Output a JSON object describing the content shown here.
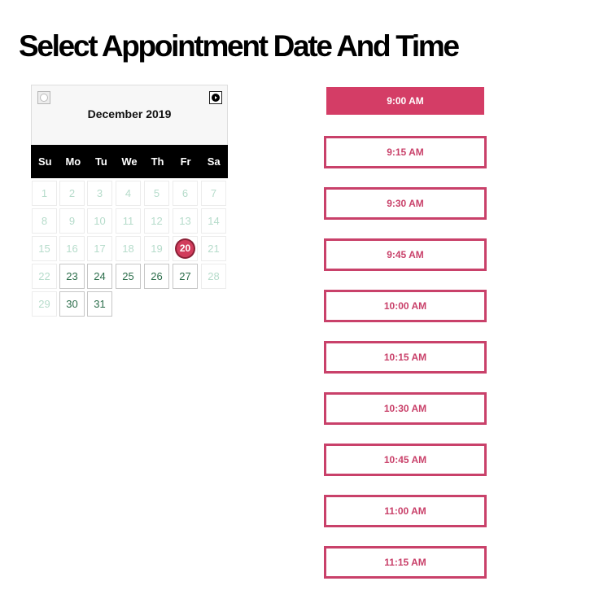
{
  "page": {
    "title": "Select Appointment Date And Time"
  },
  "calendar": {
    "month_label": "December 2019",
    "prev_icon": "prev-month-arrow-icon",
    "next_icon": "next-month-arrow-icon",
    "weekdays": [
      "Su",
      "Mo",
      "Tu",
      "We",
      "Th",
      "Fr",
      "Sa"
    ],
    "days": [
      {
        "label": "1",
        "state": "past"
      },
      {
        "label": "2",
        "state": "past"
      },
      {
        "label": "3",
        "state": "past"
      },
      {
        "label": "4",
        "state": "past"
      },
      {
        "label": "5",
        "state": "past"
      },
      {
        "label": "6",
        "state": "past"
      },
      {
        "label": "7",
        "state": "past"
      },
      {
        "label": "8",
        "state": "past"
      },
      {
        "label": "9",
        "state": "past"
      },
      {
        "label": "10",
        "state": "past"
      },
      {
        "label": "11",
        "state": "past"
      },
      {
        "label": "12",
        "state": "past"
      },
      {
        "label": "13",
        "state": "past"
      },
      {
        "label": "14",
        "state": "past"
      },
      {
        "label": "15",
        "state": "past"
      },
      {
        "label": "16",
        "state": "past"
      },
      {
        "label": "17",
        "state": "past"
      },
      {
        "label": "18",
        "state": "past"
      },
      {
        "label": "19",
        "state": "past"
      },
      {
        "label": "20",
        "state": "today"
      },
      {
        "label": "21",
        "state": "past"
      },
      {
        "label": "22",
        "state": "past"
      },
      {
        "label": "23",
        "state": "available"
      },
      {
        "label": "24",
        "state": "available"
      },
      {
        "label": "25",
        "state": "available"
      },
      {
        "label": "26",
        "state": "available"
      },
      {
        "label": "27",
        "state": "available"
      },
      {
        "label": "28",
        "state": "past"
      },
      {
        "label": "29",
        "state": "past"
      },
      {
        "label": "30",
        "state": "available"
      },
      {
        "label": "31",
        "state": "available"
      }
    ],
    "colors": {
      "header_bg": "#f7f7f7",
      "weekday_bar": "#000000",
      "past_text": "#b6dccb",
      "available_text": "#2c6e4b",
      "today_fill": "#d13c5c"
    }
  },
  "time_slots": {
    "items": [
      {
        "label": "9:00 AM",
        "selected": true
      },
      {
        "label": "9:15 AM",
        "selected": false
      },
      {
        "label": "9:30 AM",
        "selected": false
      },
      {
        "label": "9:45 AM",
        "selected": false
      },
      {
        "label": "10:00 AM",
        "selected": false
      },
      {
        "label": "10:15 AM",
        "selected": false
      },
      {
        "label": "10:30 AM",
        "selected": false
      },
      {
        "label": "10:45 AM",
        "selected": false
      },
      {
        "label": "11:00 AM",
        "selected": false
      },
      {
        "label": "11:15 AM",
        "selected": false
      }
    ],
    "colors": {
      "accent": "#c9416a",
      "selected_fill": "#d43d66"
    }
  }
}
